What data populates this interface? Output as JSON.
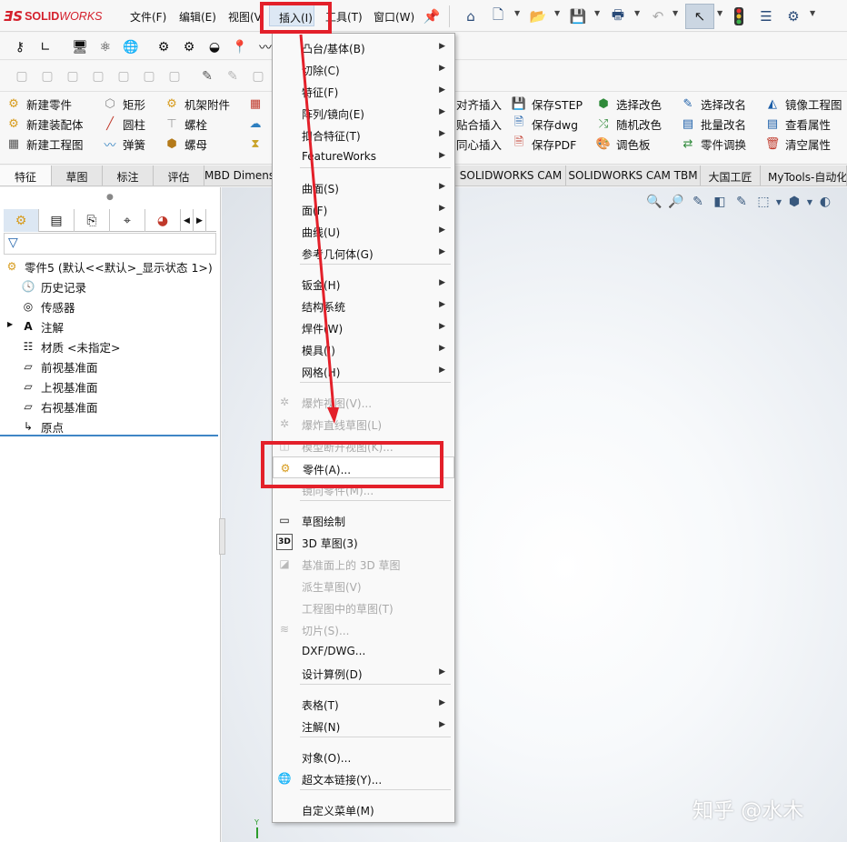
{
  "app": {
    "logo_ds": "ƎS",
    "logo_solid": "SOLID",
    "logo_works": "WORKS"
  },
  "menubar": {
    "file": "文件(F)",
    "edit": "编辑(E)",
    "view": "视图(V",
    "insert": "插入(I)",
    "tools": "工具(T)",
    "window": "窗口(W)"
  },
  "command_manager": {
    "col1": [
      "新建零件",
      "新建装配体",
      "新建工程图"
    ],
    "col2": [
      "矩形",
      "圆柱",
      "弹簧"
    ],
    "col3": [
      "机架附件",
      "螺栓",
      "螺母"
    ],
    "col5": [
      "对齐插入",
      "贴合插入",
      "同心插入"
    ],
    "col6": [
      "保存STEP",
      "保存dwg",
      "保存PDF"
    ],
    "col7": [
      "选择改色",
      "随机改色",
      "调色板"
    ],
    "col8": [
      "选择改名",
      "批量改名",
      "零件调换"
    ],
    "col9": [
      "镜像工程图",
      "查看属性",
      "清空属性"
    ]
  },
  "tabs": [
    "特征",
    "草图",
    "标注",
    "评估",
    "MBD Dimens",
    "SOLIDWORKS CAM",
    "SOLIDWORKS CAM TBM",
    "大国工匠",
    "MyTools-自动化"
  ],
  "feature_tree": {
    "root": "零件5  (默认<<默认>_显示状态 1>)",
    "items": [
      "历史记录",
      "传感器",
      "注解",
      "材质 <未指定>",
      "前视基准面",
      "上视基准面",
      "右视基准面",
      "原点"
    ]
  },
  "insert_menu": {
    "items": [
      {
        "label": "凸台/基体(B)",
        "submenu": true,
        "enabled": true
      },
      {
        "label": "切除(C)",
        "submenu": true,
        "enabled": true
      },
      {
        "label": "特征(F)",
        "submenu": true,
        "enabled": true
      },
      {
        "label": "阵列/镜向(E)",
        "submenu": true,
        "enabled": true
      },
      {
        "label": "扣合特征(T)",
        "submenu": true,
        "enabled": true
      },
      {
        "label": "FeatureWorks",
        "submenu": true,
        "enabled": true
      },
      {
        "label": "曲面(S)",
        "submenu": true,
        "enabled": true
      },
      {
        "label": "面(F)",
        "submenu": true,
        "enabled": true
      },
      {
        "label": "曲线(U)",
        "submenu": true,
        "enabled": true
      },
      {
        "label": "参考几何体(G)",
        "submenu": true,
        "enabled": true
      },
      {
        "label": "钣金(H)",
        "submenu": true,
        "enabled": true
      },
      {
        "label": "结构系统",
        "submenu": true,
        "enabled": true
      },
      {
        "label": "焊件(W)",
        "submenu": true,
        "enabled": true
      },
      {
        "label": "模具(I)",
        "submenu": true,
        "enabled": true
      },
      {
        "label": "网格(H)",
        "submenu": true,
        "enabled": true
      },
      {
        "label": "爆炸视图(V)...",
        "submenu": false,
        "enabled": false
      },
      {
        "label": "爆炸直线草图(L)",
        "submenu": false,
        "enabled": false
      },
      {
        "label": "模型断开视图(K)...",
        "submenu": false,
        "enabled": false
      },
      {
        "label": "零件(A)...",
        "submenu": false,
        "enabled": true,
        "highlighted": true
      },
      {
        "label": "镜向零件(M)...",
        "submenu": false,
        "enabled": false
      },
      {
        "label": "草图绘制",
        "submenu": false,
        "enabled": true
      },
      {
        "label": "3D 草图(3)",
        "submenu": false,
        "enabled": true
      },
      {
        "label": "基准面上的 3D 草图",
        "submenu": false,
        "enabled": false
      },
      {
        "label": "派生草图(V)",
        "submenu": false,
        "enabled": false
      },
      {
        "label": "工程图中的草图(T)",
        "submenu": false,
        "enabled": false
      },
      {
        "label": "切片(S)...",
        "submenu": false,
        "enabled": false
      },
      {
        "label": "DXF/DWG...",
        "submenu": false,
        "enabled": true
      },
      {
        "label": "设计算例(D)",
        "submenu": true,
        "enabled": true
      },
      {
        "label": "表格(T)",
        "submenu": true,
        "enabled": true
      },
      {
        "label": "注解(N)",
        "submenu": true,
        "enabled": true
      },
      {
        "label": "对象(O)...",
        "submenu": false,
        "enabled": true
      },
      {
        "label": "超文本链接(Y)...",
        "submenu": false,
        "enabled": true
      },
      {
        "label": "自定义菜单(M)",
        "submenu": false,
        "enabled": true
      }
    ]
  },
  "axis_label": "Y",
  "watermark": "知乎 @水木",
  "colors": {
    "annotation_red": "#e3202a",
    "brand_red": "#d4202c",
    "tree_rule": "#3f86c6"
  }
}
